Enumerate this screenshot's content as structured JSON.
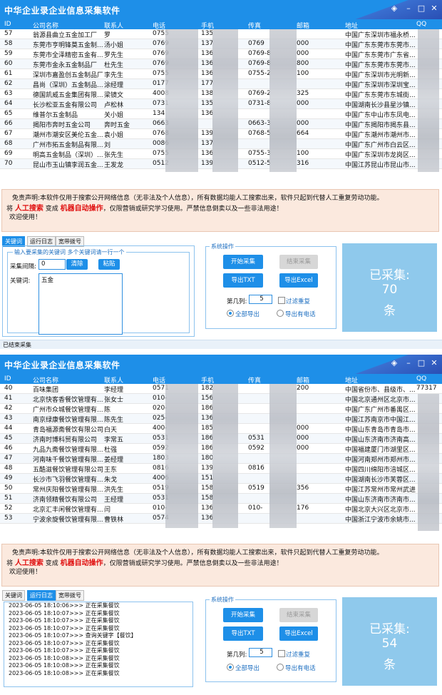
{
  "app_title": "中华企业录企业信息采集软件",
  "columns": [
    "ID",
    "公司名称",
    "联系人",
    "电话",
    "手机",
    "传真",
    "邮箱",
    "地址",
    "QQ"
  ],
  "window1": {
    "rows": [
      [
        "57",
        "翁源县曲立五金加工厂",
        "罗",
        "0755",
        "135",
        "",
        "",
        "中国广东深圳市福永桥..."
      ],
      [
        "58",
        "东莞市亨明锋莫五金制...",
        "汤小姐",
        "0769",
        "137",
        "0769",
        "000",
        "中国广东东莞市东莞市..."
      ],
      [
        "59",
        "东莞市全泽精密五金有...",
        "罗先生",
        "0769",
        "136",
        "0769-8",
        "000",
        "中国广东东莞市广东省..."
      ],
      [
        "60",
        "东莞市金永五金制品厂",
        "杜先生",
        "0769",
        "136",
        "0769-8",
        "800",
        "中国广东东莞市东莞市..."
      ],
      [
        "61",
        "深圳市嘉盈创五金制品厂",
        "李先生",
        "0755",
        "136",
        "0755-2",
        "100",
        "中国广东深圳市光明新..."
      ],
      [
        "62",
        "昌尚（深圳）五金制品...",
        "涂经理",
        "0177",
        "177",
        "",
        "",
        "中国广东深圳市深圳宝..."
      ],
      [
        "63",
        "德国凯威五金集团有限...",
        "梁镜文",
        "4008",
        "138",
        "0769-2",
        "325",
        "中国广东东莞市东城街..."
      ],
      [
        "64",
        "长沙松亚五金有限公司",
        "卢松林",
        "0731",
        "135",
        "0731-8",
        "000",
        "中国湖南长沙县星沙镇..."
      ],
      [
        "65",
        "维普尔五金制品",
        "关小姐",
        "134",
        "136",
        "",
        "",
        "中国广东中山市东凤电..."
      ],
      [
        "66",
        "揭阳市奔时五金公司",
        "奔时五金",
        "0663",
        "",
        "0663-3",
        "000",
        "中国广东揭阳市揭东县..."
      ],
      [
        "67",
        "潮州市潮安区美伦五金...",
        "袁小姐",
        "0768",
        "139",
        "0768-5",
        "664",
        "中国广东潮州市潮州市..."
      ],
      [
        "68",
        "广州市拓五金制品有限...",
        "刘",
        "0086",
        "137",
        "",
        "",
        "中国广东广州市白云区..."
      ],
      [
        "69",
        "明高五金制品（深圳）...",
        "张先生",
        "0755",
        "136",
        "0755-3",
        "100",
        "中国广东深圳市龙岗区..."
      ],
      [
        "70",
        "昆山市玉山镇李润五金...",
        "王发龙",
        "0512",
        "139",
        "0512-5",
        "316",
        "中国江苏昆山市昆山市..."
      ]
    ],
    "notice_line1_prefix": "免责声明:本软件仅用于搜索公开网络信息（无非法及个人信息），所有数据均能人工搜索出来，软件只起到代替人工重复劳动功能。",
    "notice_line2_a": "将",
    "notice_red1": "人工搜索",
    "notice_line2_b": "变成",
    "notice_red2": "机器自动操作",
    "notice_line2_c": "，仅限营销或研究学习使用。严禁信息倒卖以及一些非法用途！",
    "notice_line3": "欢迎使用！",
    "tabs": [
      "关键词",
      "运行日志",
      "宽带拨号"
    ],
    "active_tab": "关键词",
    "kw_legend": "输入要采集的关键词 多个关键词请一行一个",
    "interval_label": "采集间隔:",
    "interval_value": "0",
    "clear_btn": "清除",
    "paste_btn": "粘贴",
    "keyword_label": "关键词:",
    "keyword_value": "五金",
    "ops_legend": "系统操作",
    "start_btn": "开始采集",
    "stop_btn": "结束采集",
    "export_txt": "导出TXT",
    "export_excel": "导出Excel",
    "col_label": "第几列:",
    "col_value": "5",
    "filter_dup": "过滤重复",
    "export_all": "全部导出",
    "export_phone": "导出有电话",
    "collected_label": "已采集:",
    "collected_count": "70",
    "collected_unit": "条",
    "status": "已结束采集"
  },
  "window2": {
    "rows": [
      [
        "40",
        "百味集团",
        "李经理",
        "0571",
        "182",
        "",
        "200",
        "中国省份市、县级市、...",
        "77317"
      ],
      [
        "41",
        "北京快客香餐饮管理有...",
        "张女士",
        "010-",
        "156",
        "",
        "",
        "中国北京通州区北京市..."
      ],
      [
        "42",
        "广州市众城餐饮管理有...",
        "陈",
        "020-",
        "186",
        "",
        "",
        "中国广东广州市番禺区..."
      ],
      [
        "43",
        "南京绿康餐饮管理有限...",
        "陈先生",
        "025-",
        "136",
        "",
        "",
        "中国江苏南京市中国江..."
      ],
      [
        "44",
        "青岛福源斋餐饮有限公司",
        "白天",
        "400-",
        "185",
        "",
        "000",
        "中国山东青岛市青岛市..."
      ],
      [
        "45",
        "济南时博科贸有限公司",
        "李常五",
        "0531",
        "186",
        "0531",
        "000",
        "中国山东济南市济南高..."
      ],
      [
        "46",
        "九品九斋餐饮管理有限...",
        "杜强",
        "0592",
        "186",
        "0592",
        "000",
        "中国福建厦门市湖里区..."
      ],
      [
        "47",
        "河南味千餐饮管理有限...",
        "姜经理",
        "1803",
        "180",
        "",
        "",
        "中国河南郑州市郑州市..."
      ],
      [
        "48",
        "五酷滋餐饮管理有限公司",
        "王东",
        "0816",
        "139",
        "0816",
        "",
        "中国四川绵阳市涪城区..."
      ],
      [
        "49",
        "长沙市飞羽餐饮管理有...",
        "朱戈",
        "4006",
        "151",
        "",
        "",
        "中国湖南长沙市芙蓉区..."
      ],
      [
        "50",
        "常州庆阳餐饮管理有限...",
        "洪先生",
        "0519",
        "158",
        "0519",
        "356",
        "中国江苏常州市常州武进..."
      ],
      [
        "51",
        "济南领精餐饮有限公司",
        "王经理",
        "0531",
        "158",
        "",
        "",
        "中国山东济南市济南市..."
      ],
      [
        "52",
        "北京汇丰闲餐饮管理有...",
        "闫",
        "010-",
        "136",
        "010-",
        "176",
        "中国北京大兴区北京市..."
      ],
      [
        "53",
        "宁波余旋餐饮管理有限...",
        "曹铁林",
        "0574",
        "136",
        "",
        "",
        "中国浙江宁波市余姚市..."
      ]
    ],
    "tabs": [
      "关键词",
      "运行日志",
      "宽带拨号"
    ],
    "active_tab": "运行日志",
    "log": [
      "2023-06-05 18:10:06>>> 正在采集餐饮",
      "2023-06-05 18:10:07>>> 正在采集餐饮",
      "2023-06-05 18:10:07>>> 正在采集餐饮",
      "2023-06-05 18:10:07>>> 正在采集餐饮",
      "2023-06-05 18:10:07>>> 查询关键字【餐饮】",
      "2023-06-05 18:10:07>>> 正在采集餐饮",
      "2023-06-05 18:10:07>>> 正在采集餐饮",
      "2023-06-05 18:10:08>>> 正在采集餐饮",
      "2023-06-05 18:10:08>>> 正在采集餐饮",
      "2023-06-05 18:10:08>>> 正在采集餐饮"
    ],
    "collected_count": "54"
  },
  "colors": {
    "accent": "#1e8fe8",
    "notice_bg": "#fbe9de",
    "counter_bg": "#8fc9ec",
    "red": "#e01010"
  }
}
